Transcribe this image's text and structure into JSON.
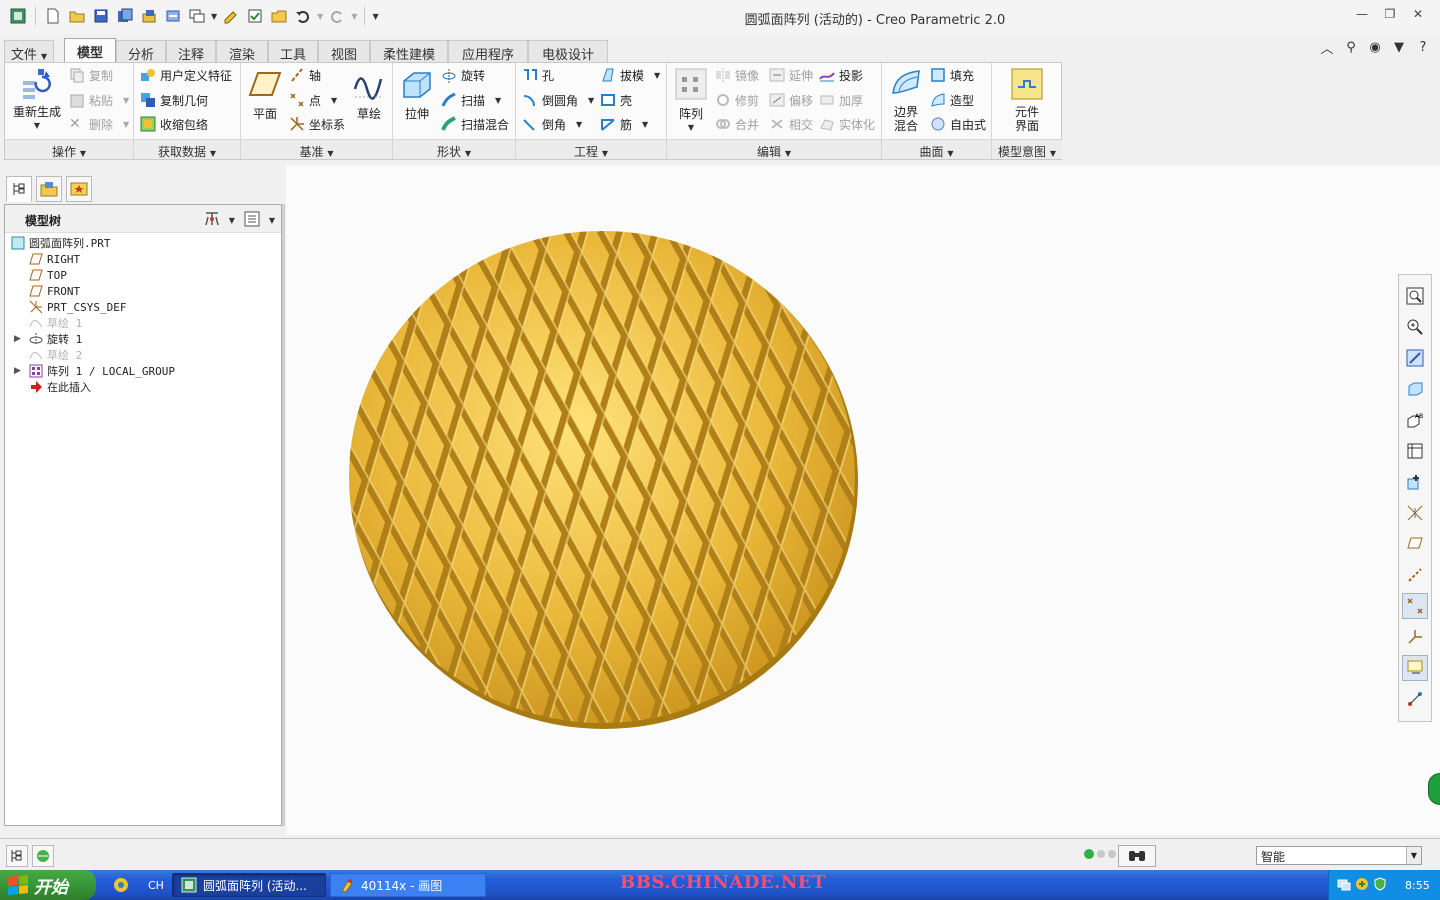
{
  "window": {
    "title": "圆弧面阵列 (活动的) - Creo Parametric 2.0"
  },
  "tabs": [
    {
      "label": "文件"
    },
    {
      "label": "模型"
    },
    {
      "label": "分析"
    },
    {
      "label": "注释"
    },
    {
      "label": "渲染"
    },
    {
      "label": "工具"
    },
    {
      "label": "视图"
    },
    {
      "label": "柔性建模"
    },
    {
      "label": "应用程序"
    },
    {
      "label": "电极设计"
    }
  ],
  "ribbon": {
    "operations": {
      "name": "操作",
      "regenerate": "重新生成",
      "copy": "复制",
      "paste": "粘贴",
      "delete": "删除"
    },
    "get_data": {
      "name": "获取数据",
      "udf": "用户定义特征",
      "copy_geom": "复制几何",
      "shrinkwrap": "收缩包络"
    },
    "datum": {
      "name": "基准",
      "plane": "平面",
      "axis": "轴",
      "point": "点",
      "csys": "坐标系",
      "sketch": "草绘"
    },
    "shapes": {
      "name": "形状",
      "extrude": "拉伸",
      "revolve": "旋转",
      "sweep": "扫描",
      "swept_blend": "扫描混合"
    },
    "engineering": {
      "name": "工程",
      "hole": "孔",
      "round": "倒圆角",
      "chamfer": "倒角",
      "draft": "拔模",
      "shell": "壳",
      "rib": "筋"
    },
    "editing": {
      "name": "编辑",
      "pattern": "阵列",
      "mirror": "镜像",
      "trim": "修剪",
      "merge": "合并",
      "extend": "延伸",
      "offset": "偏移",
      "intersect": "相交",
      "project": "投影",
      "thicken": "加厚",
      "solidify": "实体化"
    },
    "surfaces": {
      "name": "曲面",
      "boundary_blend_1": "边界",
      "boundary_blend_2": "混合",
      "fill": "填充",
      "style": "造型",
      "freestyle": "自由式"
    },
    "model_intent": {
      "name": "模型意图",
      "component_interface_1": "元件",
      "component_interface_2": "界面"
    }
  },
  "model_tree": {
    "title": "模型树",
    "items": [
      {
        "label": "圆弧面阵列.PRT",
        "icon": "part-icon",
        "dim": false
      },
      {
        "label": "RIGHT",
        "icon": "datum-plane-icon",
        "dim": false
      },
      {
        "label": "TOP",
        "icon": "datum-plane-icon",
        "dim": false
      },
      {
        "label": "FRONT",
        "icon": "datum-plane-icon",
        "dim": false
      },
      {
        "label": "PRT_CSYS_DEF",
        "icon": "csys-icon",
        "dim": false
      },
      {
        "label": "草绘 1",
        "icon": "sketch-icon",
        "dim": true
      },
      {
        "label": "旋转 1",
        "icon": "revolve-icon",
        "dim": false
      },
      {
        "label": "草绘 2",
        "icon": "sketch-icon",
        "dim": true
      },
      {
        "label": "阵列 1 / LOCAL_GROUP",
        "icon": "pattern-icon",
        "dim": false
      },
      {
        "label": "在此插入",
        "icon": "insert-arrow-icon",
        "dim": false
      }
    ]
  },
  "status": {
    "filter_value": "智能"
  },
  "taskbar": {
    "start": "开始",
    "lang": "CH",
    "items": [
      {
        "label": "圆弧面阵列 (活动..."
      },
      {
        "label": "40114x - 画图"
      }
    ],
    "watermark": "BBS.CHINADE.NET",
    "clock": "8:55"
  },
  "colors": {
    "part_gold": "#e5b536",
    "part_highlight": "#ffe27a",
    "part_groove": "#a77a12",
    "accent_blue": "#245edb"
  }
}
